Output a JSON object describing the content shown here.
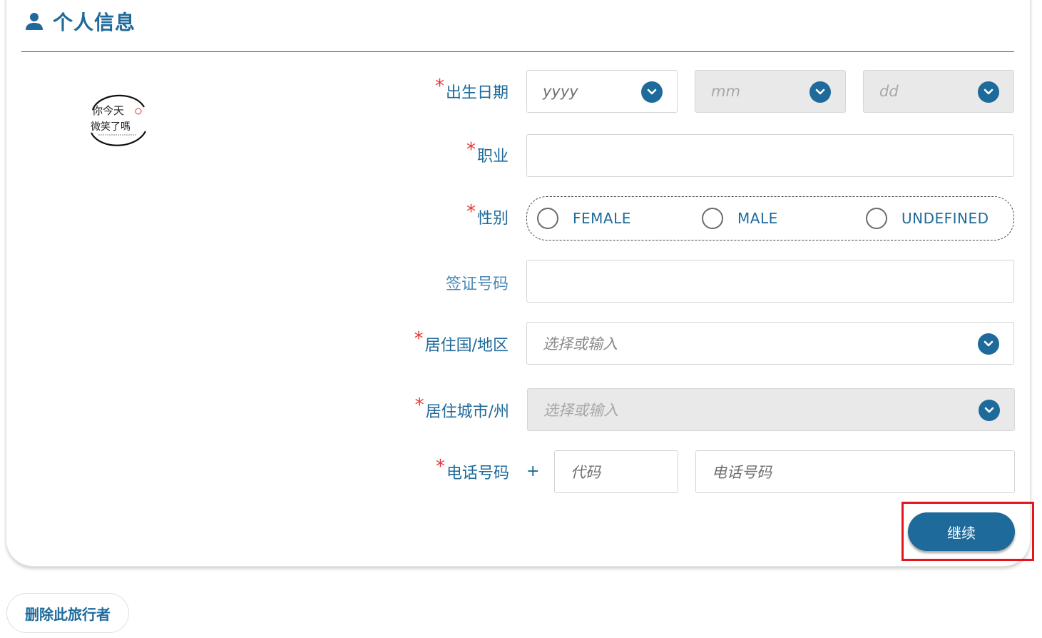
{
  "section": {
    "title": "个人信息",
    "icon": "person-icon"
  },
  "logo": {
    "line1": "你今天",
    "line2": "微笑了嗎",
    "icon": "smiling-logo-icon"
  },
  "birthdate": {
    "label": "出生日期",
    "required_mark": "*",
    "year_placeholder": "yyyy",
    "month_placeholder": "mm",
    "day_placeholder": "dd"
  },
  "occupation": {
    "label": "职业",
    "required_mark": "*",
    "value": ""
  },
  "gender": {
    "label": "性别",
    "required_mark": "*",
    "options": [
      "FEMALE",
      "MALE",
      "UNDEFINED"
    ],
    "selected": null
  },
  "visa": {
    "label": "签证号码",
    "value": ""
  },
  "country": {
    "label": "居住国/地区",
    "required_mark": "*",
    "placeholder": "选择或输入"
  },
  "city": {
    "label": "居住城市/州",
    "required_mark": "*",
    "placeholder": "选择或输入"
  },
  "phone": {
    "label": "电话号码",
    "required_mark": "*",
    "plus": "+",
    "code_placeholder": "代码",
    "number_placeholder": "电话号码"
  },
  "buttons": {
    "continue": "继续",
    "delete_traveler": "删除此旅行者"
  },
  "colors": {
    "accent": "#1e6a9b",
    "required": "#e53935",
    "highlight": "#e8141c",
    "disabled_bg": "#e9e9e9"
  }
}
